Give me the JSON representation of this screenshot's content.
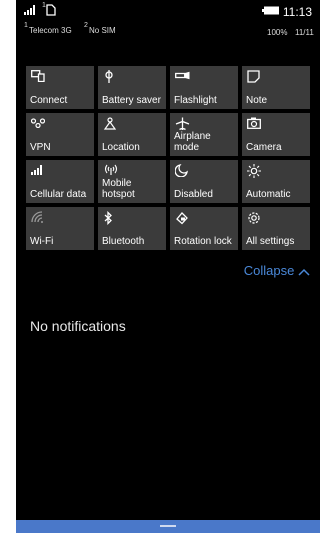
{
  "status_bar": {
    "sim1_index": "1",
    "sim1_network": "Telecom 3G",
    "sim2_index": "2",
    "sim2_network": "No SIM",
    "battery_percent": "100%",
    "time": "11:13",
    "date": "11/11",
    "icons": [
      "signal-icon",
      "sim-icon",
      "battery-icon"
    ]
  },
  "tiles": [
    {
      "label": "Connect",
      "icon": "connect-icon"
    },
    {
      "label": "Battery saver",
      "icon": "battery-saver-icon"
    },
    {
      "label": "Flashlight",
      "icon": "flashlight-icon"
    },
    {
      "label": "Note",
      "icon": "note-icon"
    },
    {
      "label": "VPN",
      "icon": "vpn-icon"
    },
    {
      "label": "Location",
      "icon": "location-icon"
    },
    {
      "label": "Airplane mode",
      "icon": "airplane-icon"
    },
    {
      "label": "Camera",
      "icon": "camera-icon"
    },
    {
      "label": "Cellular data",
      "icon": "cellular-data-icon"
    },
    {
      "label": "Mobile hotspot",
      "icon": "hotspot-icon"
    },
    {
      "label": "Disabled",
      "icon": "quiet-hours-icon"
    },
    {
      "label": "Automatic",
      "icon": "brightness-icon"
    },
    {
      "label": "Wi-Fi",
      "icon": "wifi-icon"
    },
    {
      "label": "Bluetooth",
      "icon": "bluetooth-icon"
    },
    {
      "label": "Rotation lock",
      "icon": "rotation-lock-icon"
    },
    {
      "label": "All settings",
      "icon": "settings-icon"
    }
  ],
  "collapse_label": "Collapse",
  "notifications_empty": "No notifications",
  "colors": {
    "background": "#000000",
    "tile": "#3b3b3b",
    "accent": "#4a88d8",
    "bottom_bar": "#4a78c9"
  }
}
